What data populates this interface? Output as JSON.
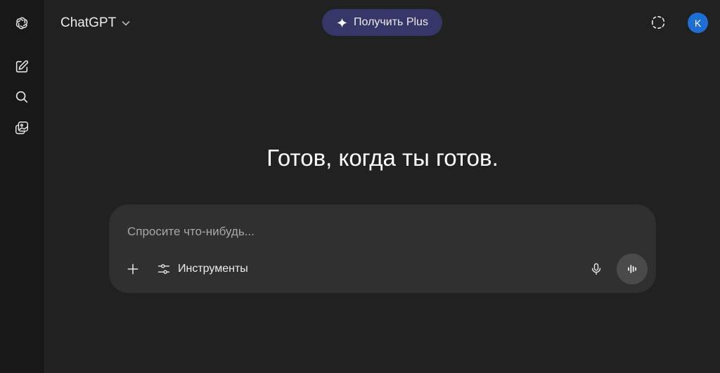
{
  "sidebar": {
    "logo_icon": "openai-logo-icon",
    "items": [
      {
        "icon": "new-chat-icon"
      },
      {
        "icon": "search-icon"
      },
      {
        "icon": "images-icon"
      }
    ]
  },
  "header": {
    "model_name": "ChatGPT",
    "upgrade_label": "Получить Plus",
    "avatar_initial": "K",
    "avatar_color": "#1f6ed4",
    "upgrade_color": "#373669"
  },
  "main": {
    "heading": "Готов, когда ты готов."
  },
  "composer": {
    "placeholder": "Спросите что-нибудь...",
    "tools_label": "Инструменты"
  }
}
